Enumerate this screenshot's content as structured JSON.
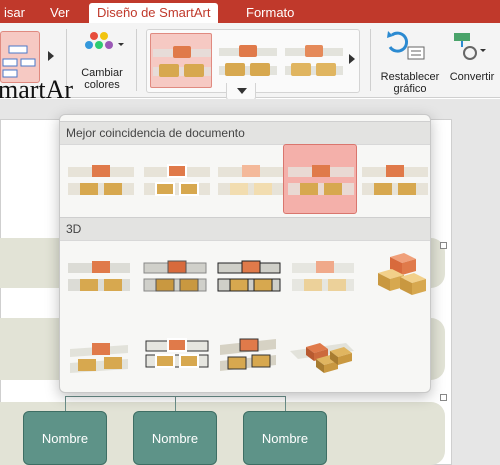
{
  "tabs": [
    {
      "label": "isar"
    },
    {
      "label": "Ver"
    },
    {
      "label": "Diseño de SmartArt",
      "active": true
    },
    {
      "label": "Formato"
    }
  ],
  "ribbon": {
    "change_colors_label": "Cambiar\ncolores",
    "reset_label": "Restablecer\ngráfico",
    "convert_label": "Convertir"
  },
  "panel": {
    "section_best": "Mejor coincidencia de documento",
    "section_3d": "3D",
    "best_items": 5,
    "selected_best_index": 3
  },
  "slide": {
    "title_fragment": "martAr",
    "nodes": [
      "Nombre",
      "Nombre",
      "Nombre"
    ]
  },
  "colors": {
    "ribbon_red": "#c0392b",
    "node_teal": "#5e9388",
    "selection_pink": "#f4b0aa"
  }
}
